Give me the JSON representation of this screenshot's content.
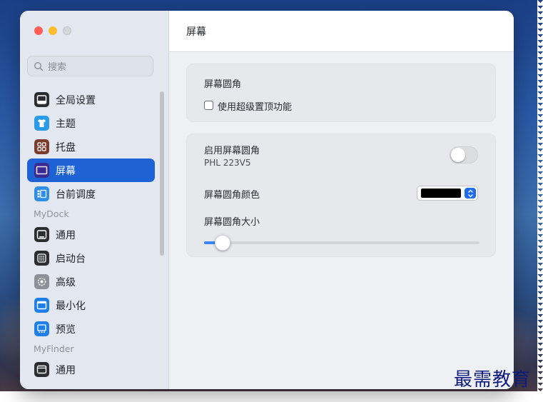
{
  "search": {
    "placeholder": "搜索"
  },
  "sidebar": {
    "items": [
      {
        "label": "全局设置",
        "icon": "window-icon",
        "color": "#2b2d31"
      },
      {
        "label": "主题",
        "icon": "shirt-icon",
        "color": "#2a9be8"
      },
      {
        "label": "托盘",
        "icon": "grid-icon",
        "color": "#7a3c2c"
      },
      {
        "label": "屏幕",
        "icon": "screen-icon",
        "color": "#3b2a8f",
        "active": true
      },
      {
        "label": "台前调度",
        "icon": "stage-manager-icon",
        "color": "#2f8fe6"
      }
    ],
    "section_mydock": "MyDock",
    "mydock_items": [
      {
        "label": "通用",
        "icon": "dock-icon",
        "color": "#2b2d31"
      },
      {
        "label": "启动台",
        "icon": "launchpad-icon",
        "color": "#2b2d31"
      },
      {
        "label": "高级",
        "icon": "gear-icon",
        "color": "#8d9096"
      },
      {
        "label": "最小化",
        "icon": "minimize-icon",
        "color": "#1f7fe8"
      },
      {
        "label": "预览",
        "icon": "preview-icon",
        "color": "#1f7fe8"
      }
    ],
    "section_myfinder": "MyFinder",
    "myfinder_items": [
      {
        "label": "通用",
        "icon": "finder-general-icon",
        "color": "#2b2d31"
      }
    ]
  },
  "header": {
    "title": "屏幕"
  },
  "card1": {
    "title": "屏幕圆角",
    "checkbox_label": "使用超级置顶功能",
    "checkbox_checked": false
  },
  "card2": {
    "enable_label": "启用屏幕圆角",
    "display_name": "PHL 223V5",
    "toggle_on": false,
    "color_label": "屏幕圆角颜色",
    "color_value": "#000000",
    "size_label": "屏幕圆角大小",
    "size_fraction": 0.04
  },
  "watermark": "最需教育",
  "colors": {
    "accent": "#1e62d6"
  }
}
